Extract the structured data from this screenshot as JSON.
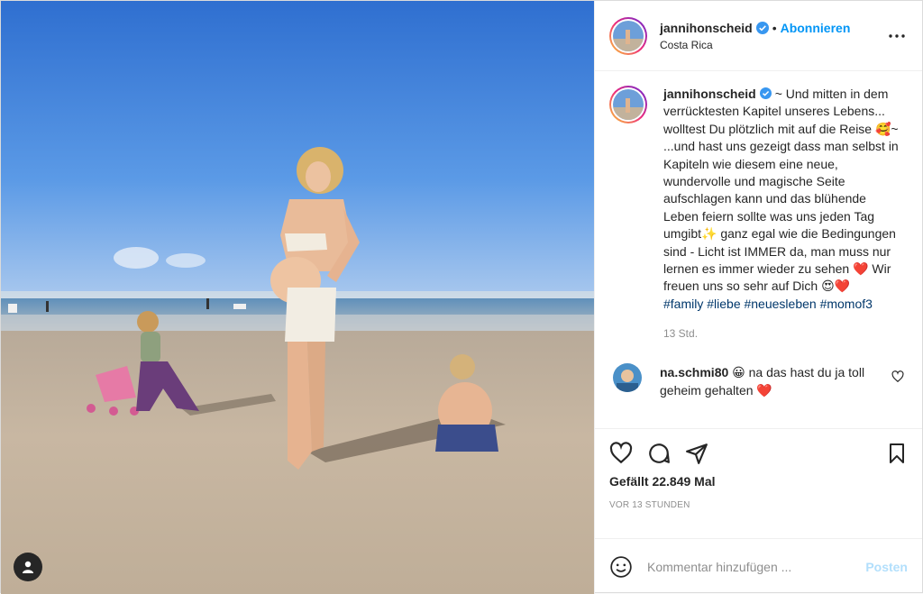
{
  "colors": {
    "accent": "#0095f6",
    "hashtag": "#00376b",
    "heart": "#ed4956",
    "muted": "#8e8e8e"
  },
  "photo": {
    "description_icon": "user-tag-icon"
  },
  "header": {
    "username": "jannihonscheid",
    "separator": "•",
    "follow_label": "Abonnieren",
    "location": "Costa Rica",
    "more_icon": "more-horizontal-icon"
  },
  "caption": {
    "username": "jannihonscheid",
    "text": "~ Und mitten in dem verrücktesten Kapitel unseres Lebens... wolltest Du plötzlich mit auf die Reise 🥰~\n...und hast uns gezeigt dass man selbst in Kapiteln wie diesem eine neue, wundervolle und magische Seite aufschlagen kann und das blühende Leben feiern sollte was uns jeden Tag umgibt✨ ganz egal wie die Bedingungen sind - Licht ist IMMER da, man muss nur lernen es immer wieder zu sehen ❤️ Wir freuen uns so sehr auf Dich 😍❤️",
    "hashtags": "#family #liebe #neuesleben #momof3",
    "time": "13 Std."
  },
  "comment": {
    "username": "na.schmi80",
    "text": "😀 na das hast du ja toll geheim gehalten ❤️"
  },
  "actions": {
    "likes": "Gefällt 22.849 Mal",
    "ago": "VOR 13 STUNDEN"
  },
  "add_comment": {
    "placeholder": "Kommentar hinzufügen ...",
    "post_label": "Posten"
  }
}
